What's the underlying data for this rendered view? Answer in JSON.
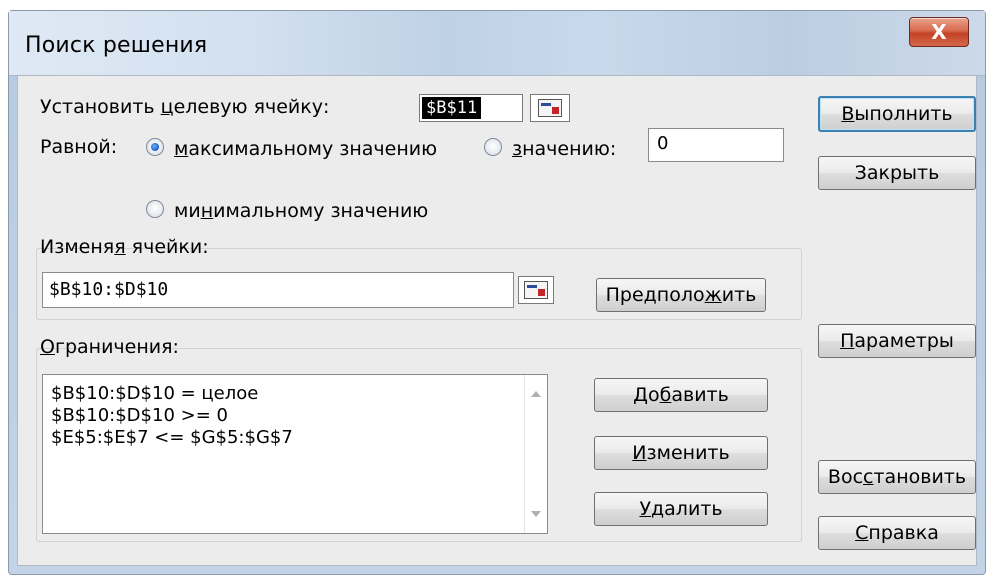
{
  "window": {
    "title": "Поиск решения",
    "close_label": "X"
  },
  "target": {
    "label_pre": "Установить ",
    "label_u": "ц",
    "label_post": "елевую ячейку:",
    "value": "$B$11"
  },
  "equal": {
    "label": "Равной:",
    "max_u": "м",
    "max_rest": "аксимальному значению",
    "value_u": "з",
    "value_rest": "начению:",
    "value_input": "0",
    "min_pre": "ми",
    "min_u": "н",
    "min_rest": "имальному значению",
    "selected": "max"
  },
  "changing": {
    "label_pre": "Изменя",
    "label_u": "я",
    "label_post": " ячейки:",
    "value": "$B$10:$D$10",
    "guess_pre": "Предполо",
    "guess_u": "ж",
    "guess_post": "ить"
  },
  "constraints": {
    "label_u": "О",
    "label_rest": "граничения:",
    "items": [
      "$B$10:$D$10 = целое",
      "$B$10:$D$10 >= 0",
      "$E$5:$E$7 <= $G$5:$G$7"
    ],
    "add_pre": "До",
    "add_u": "б",
    "add_post": "авить",
    "change_u": "И",
    "change_rest": "зменить",
    "delete_u": "У",
    "delete_rest": "далить"
  },
  "buttons": {
    "run_u": "В",
    "run_rest": "ыполнить",
    "close": "Закрыть",
    "params_u": "П",
    "params_rest": "араметры",
    "restore_pre": "Вос",
    "restore_u": "с",
    "restore_post": "тановить",
    "help_u": "С",
    "help_rest": "правка"
  }
}
